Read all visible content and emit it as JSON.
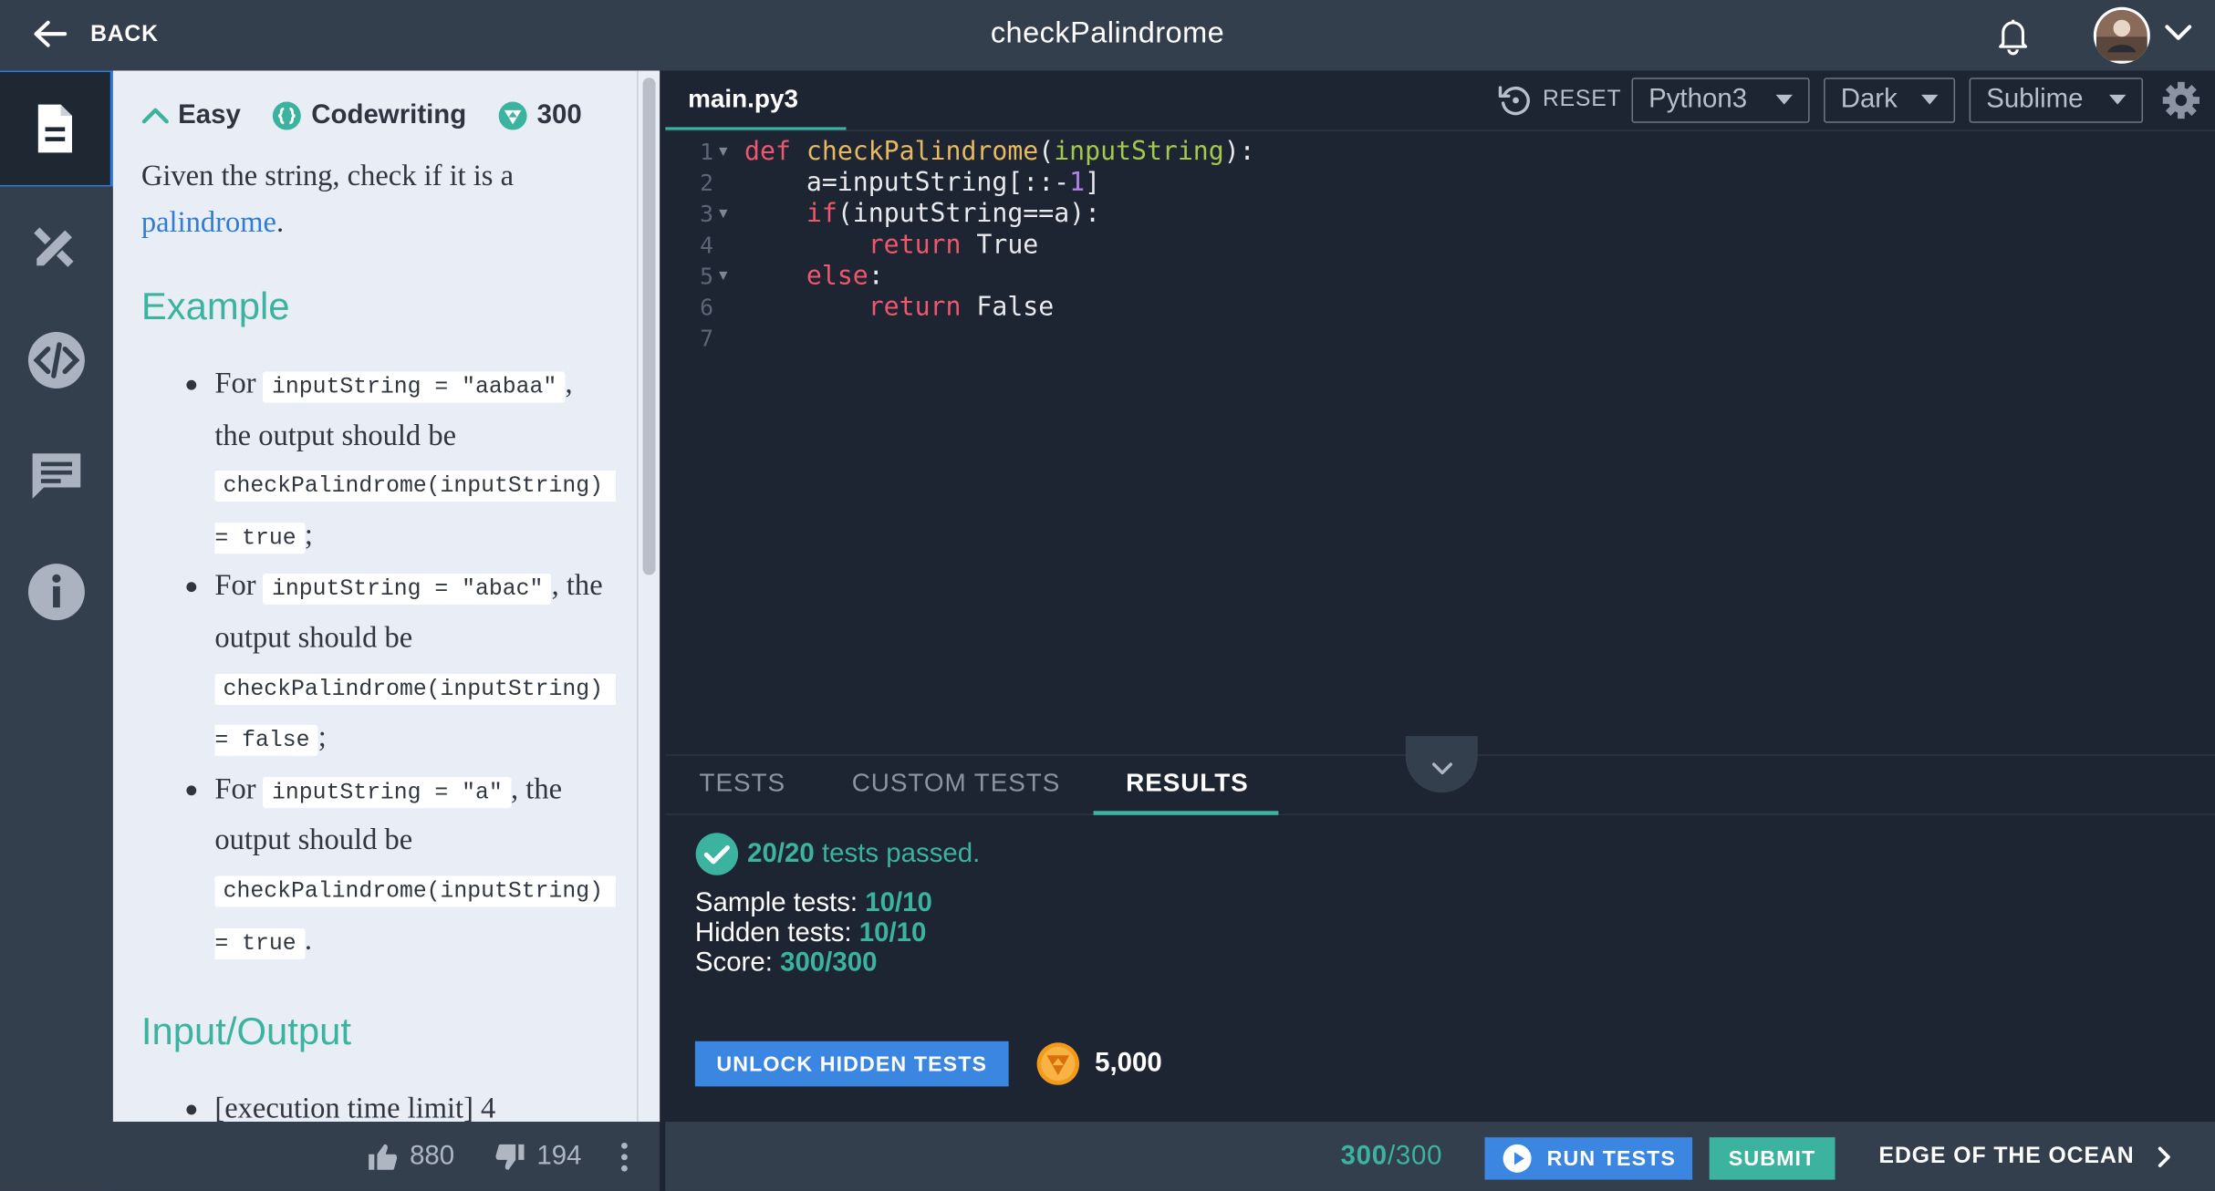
{
  "header": {
    "back_label": "BACK",
    "title": "checkPalindrome"
  },
  "description": {
    "difficulty": "Easy",
    "type": "Codewriting",
    "points": "300",
    "intro_text": "Given the string, check if it is a ",
    "intro_link": "palindrome",
    "intro_end": ".",
    "example_heading": "Example",
    "examples": [
      {
        "a": "For ",
        "b": "inputString = \"aabaa\"",
        "c": ", the output should be ",
        "d": "checkPalindrome(inputString) = true",
        "e": ";"
      },
      {
        "a": "For ",
        "b": "inputString = \"abac\"",
        "c": ", the output should be ",
        "d": "checkPalindrome(inputString) = false",
        "e": ";"
      },
      {
        "a": "For ",
        "b": "inputString = \"a\"",
        "c": ", the output should be ",
        "d": "checkPalindrome(inputString) = true",
        "e": "."
      }
    ],
    "io_heading": "Input/Output",
    "io_items": [
      "[execution time limit] 4"
    ]
  },
  "feedback": {
    "likes": "880",
    "dislikes": "194"
  },
  "editor": {
    "file_tab": "main.py3",
    "reset_label": "RESET",
    "language": "Python3",
    "theme": "Dark",
    "keymap": "Sublime",
    "code_lines": [
      "def checkPalindrome(inputString):",
      "    a=inputString[::-1]",
      "    if(inputString==a):",
      "        return True",
      "    else:",
      "        return False",
      ""
    ]
  },
  "bottom_tabs": [
    "TESTS",
    "CUSTOM TESTS",
    "RESULTS"
  ],
  "results": {
    "passed_count": "20/20",
    "passed_text": " tests passed.",
    "sample_label": "Sample tests: ",
    "sample_value": "10/10",
    "hidden_label": "Hidden tests: ",
    "hidden_value": "10/10",
    "score_label": "Score: ",
    "score_value": "300/300",
    "unlock_label": "UNLOCK HIDDEN TESTS",
    "coins": "5,000"
  },
  "footer": {
    "score_current": "300",
    "score_total": "/300",
    "run_label": "RUN TESTS",
    "submit_label": "SUBMIT",
    "next_label": "EDGE OF THE OCEAN"
  },
  "colors": {
    "accent_green": "#3bb39e",
    "accent_blue": "#3a86e0",
    "bar": "#343f4e",
    "editor_bg": "#1e2532"
  }
}
